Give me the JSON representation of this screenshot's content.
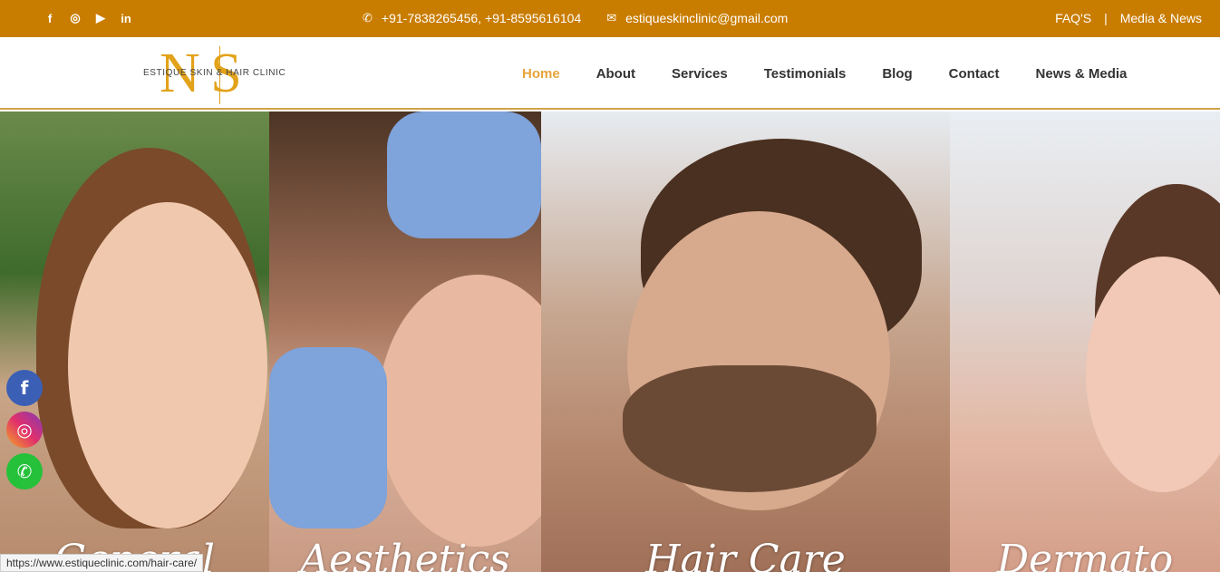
{
  "topbar": {
    "social_icons": [
      "facebook-icon",
      "instagram-icon",
      "youtube-icon",
      "linkedin-icon"
    ],
    "phone": "+91-7838265456, +91-8595616104",
    "email": "estiqueskinclinic@gmail.com",
    "faq": "FAQ'S",
    "separator": "|",
    "media": "Media & News",
    "bg_color": "#c97d00"
  },
  "nav": {
    "logo_monogram": "N|S",
    "logo_text": "ESTIQUE SKIN & HAIR CLINIC",
    "items": [
      "Home",
      "About",
      "Services",
      "Testimonials",
      "Blog",
      "Contact",
      "News & Media"
    ],
    "active": "Home",
    "active_color": "#e7a43a"
  },
  "hero": {
    "panels": [
      "General",
      "Aesthetics",
      "Hair Care",
      "Dermato"
    ]
  },
  "float_social": [
    "facebook-icon",
    "instagram-icon",
    "whatsapp-icon"
  ],
  "status": {
    "url": "https://www.estiqueclinic.com/hair-care/"
  }
}
